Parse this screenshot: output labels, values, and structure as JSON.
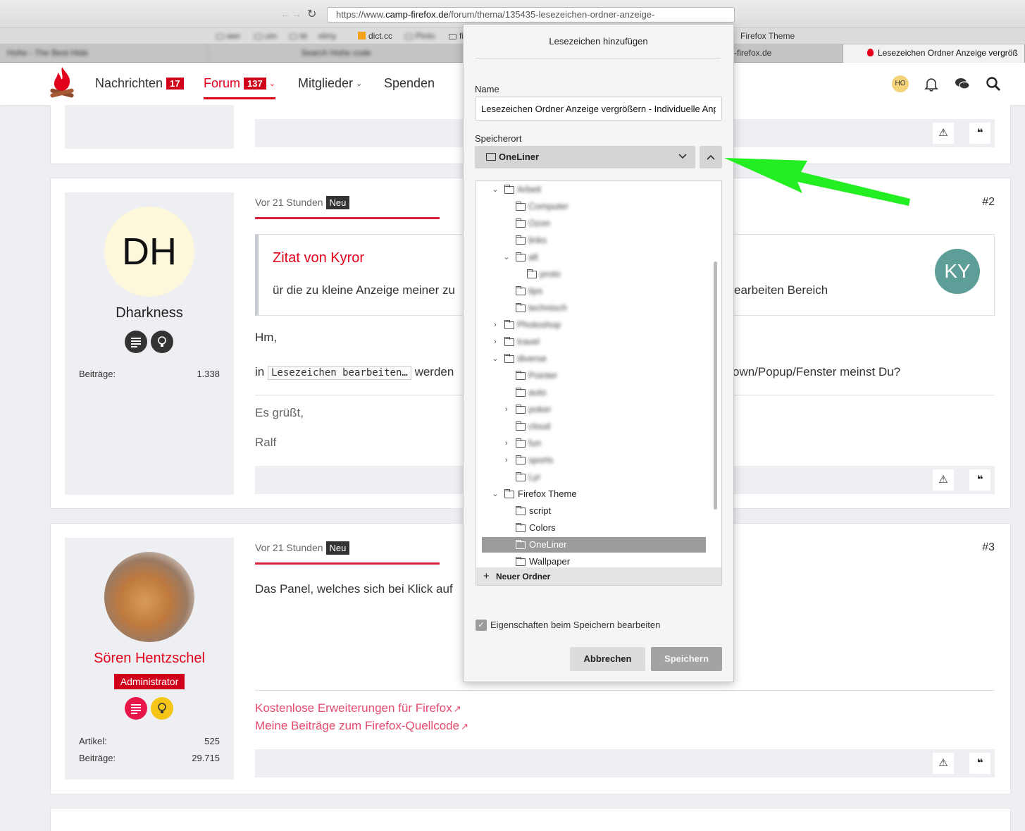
{
  "browser": {
    "url_prefix": "https://www.",
    "url_host": "camp-firefox.de",
    "url_path": "/forum/thema/135435-lesezeichen-ordner-anzeige-"
  },
  "bookmarks_bar": {
    "items": [
      "dict.cc",
      "Firefox Theme"
    ]
  },
  "tabs": {
    "items": [
      "-firefox.de",
      "Lesezeichen Ordner Anzeige vergröß"
    ]
  },
  "site_nav": {
    "messages_label": "Nachrichten",
    "messages_count": "17",
    "forum_label": "Forum",
    "forum_count": "137",
    "members_label": "Mitglieder",
    "donate_label": "Spenden",
    "user_initials": "HO"
  },
  "post2": {
    "avatar_initials": "DH",
    "username": "Dharkness",
    "stat_label": "Beiträge:",
    "stat_value": "1.338",
    "time": "Vor 21 Stunden",
    "new_badge": "Neu",
    "number": "#2",
    "quote_title": "Zitat von Kyror",
    "quote_text_left": "ür die zu kleine Anzeige meiner zu",
    "quote_text_right": "earbeiten Bereich",
    "quote_avatar": "KY",
    "line1": "Hm,",
    "line2_pre": "in",
    "line2_code": "Lesezeichen bearbeiten…",
    "line2_mid": "werden",
    "line2_right": "own/Popup/Fenster meinst Du?",
    "greeting": "Es grüßt,",
    "signature": "Ralf"
  },
  "post3": {
    "username": "Sören Hentzschel",
    "role": "Administrator",
    "stat1_label": "Artikel:",
    "stat1_value": "525",
    "stat2_label": "Beiträge:",
    "stat2_value": "29.715",
    "time": "Vor 21 Stunden",
    "new_badge": "Neu",
    "number": "#3",
    "text": "Das Panel, welches sich bei Klick auf",
    "link1": "Kostenlose Erweiterungen für Firefox",
    "link2": "Meine Beiträge zum Firefox-Quellcode"
  },
  "panel": {
    "title": "Lesezeichen hinzufügen",
    "name_label": "Name",
    "name_value": "Lesezeichen Ordner Anzeige vergrößern - Individuelle Anpassungen",
    "location_label": "Speicherort",
    "location_value": "OneLiner",
    "tree": [
      {
        "label": "Firefox Theme",
        "twisty": "open"
      },
      {
        "label": "script",
        "twisty": ""
      },
      {
        "label": "Colors",
        "twisty": ""
      },
      {
        "label": "OneLiner",
        "twisty": "",
        "selected": true
      },
      {
        "label": "Wallpaper",
        "twisty": ""
      }
    ],
    "new_folder": "Neuer Ordner",
    "checkbox_label": "Eigenschaften beim Speichern bearbeiten",
    "cancel": "Abbrechen",
    "save": "Speichern"
  },
  "colors": {
    "accent": "#e2001a",
    "arrow": "#22ee22"
  }
}
